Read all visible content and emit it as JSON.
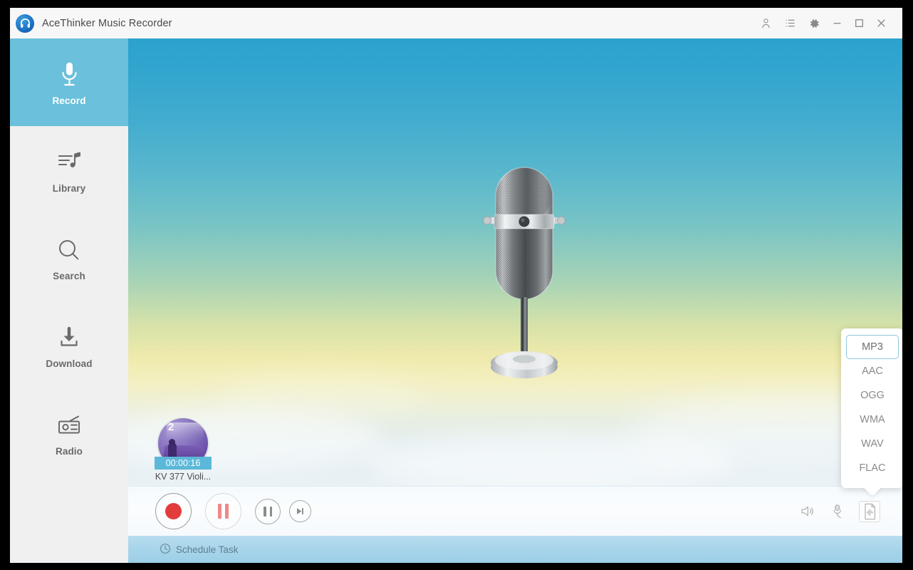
{
  "window": {
    "title": "AceThinker Music Recorder",
    "logo_icon": "headphones-icon"
  },
  "titlebar": {
    "account_icon": "account-icon",
    "list_icon": "list-icon",
    "settings_icon": "gear-icon",
    "minimize_icon": "minimize-icon",
    "maximize_icon": "maximize-icon",
    "close_icon": "close-icon"
  },
  "sidebar": {
    "items": [
      {
        "label": "Record",
        "icon": "microphone-icon",
        "active": true
      },
      {
        "label": "Library",
        "icon": "playlist-music-icon",
        "active": false
      },
      {
        "label": "Search",
        "icon": "search-icon",
        "active": false
      },
      {
        "label": "Download",
        "icon": "download-icon",
        "active": false
      },
      {
        "label": "Radio",
        "icon": "radio-icon",
        "active": false
      }
    ]
  },
  "stage": {
    "illustration": "vintage-microphone-illustration",
    "background_colors": {
      "top": "#2ba2cd",
      "middle": "#a6d3b6",
      "warm": "#f3efbe",
      "bottom": "#e9f1f5"
    }
  },
  "recordings": [
    {
      "duration": "00:00:16",
      "title": "KV 377 Violi...",
      "art": "purple-album-art"
    }
  ],
  "controls": {
    "record_label": "Record",
    "record_icon": "record-icon",
    "pause_label": "Pause",
    "pause_icon": "pause-icon",
    "pause_small_label": "Pause",
    "pause_small_icon": "pause-icon",
    "skip_label": "Skip to end",
    "skip_icon": "skip-end-icon",
    "accent_record_color": "#e23c3c",
    "accent_pause_color": "#ef8888"
  },
  "utilities": [
    {
      "name": "volume-icon",
      "label": "System Sound"
    },
    {
      "name": "microphone-plug-icon",
      "label": "Microphone"
    },
    {
      "name": "audio-format-icon",
      "label": "Output Format"
    }
  ],
  "schedule": {
    "label": "Schedule Task",
    "icon": "clock-icon"
  },
  "format_dropdown": {
    "selected": "MP3",
    "options": [
      "MP3",
      "AAC",
      "OGG",
      "WMA",
      "WAV",
      "FLAC"
    ],
    "selected_border_color": "#8fc8dc"
  }
}
